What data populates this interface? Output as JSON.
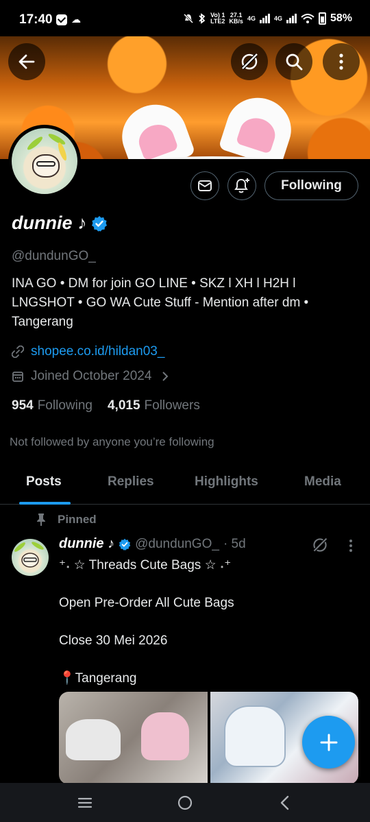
{
  "status_bar": {
    "time": "17:40",
    "volte": "Vo) 1",
    "lte": "LTE2",
    "speed": "27.1",
    "speed_unit": "KB/s",
    "net1": "4G",
    "net2": "4G",
    "battery": "58%"
  },
  "header": {
    "back_icon": "arrow-left-icon",
    "grok_icon": "grok-icon",
    "search_icon": "search-icon",
    "more_icon": "more-vertical-icon"
  },
  "profile": {
    "name": "dunnie ♪",
    "handle": "@dundunGO_",
    "bio": "INA GO • DM for join GO LINE • SKZ l XH l H2H l LNGSHOT • GO WA Cute Stuff - Mention after dm • Tangerang",
    "link": "shopee.co.id/hildan03_",
    "joined": "Joined October 2024",
    "following_count": "954",
    "following_label": "Following",
    "followers_count": "4,015",
    "followers_label": "Followers",
    "not_followed": "Not followed by anyone you’re following",
    "follow_button": "Following"
  },
  "tabs": [
    {
      "label": "Posts",
      "active": true
    },
    {
      "label": "Replies",
      "active": false
    },
    {
      "label": "Highlights",
      "active": false
    },
    {
      "label": "Media",
      "active": false
    }
  ],
  "post": {
    "pinned_label": "Pinned",
    "author": "dunnie ♪",
    "handle": "@dundunGO_",
    "time": "· 5d",
    "line1": "⁺˖ ☆ Threads Cute Bags ☆ ˖⁺",
    "line2": "Open Pre-Order All Cute Bags",
    "line3": "Close 30 Mei 2026",
    "line4": "📍Tangerang"
  },
  "colors": {
    "accent": "#1d9bf0",
    "muted": "#71767b",
    "text": "#e7e9ea",
    "background": "#000000"
  }
}
